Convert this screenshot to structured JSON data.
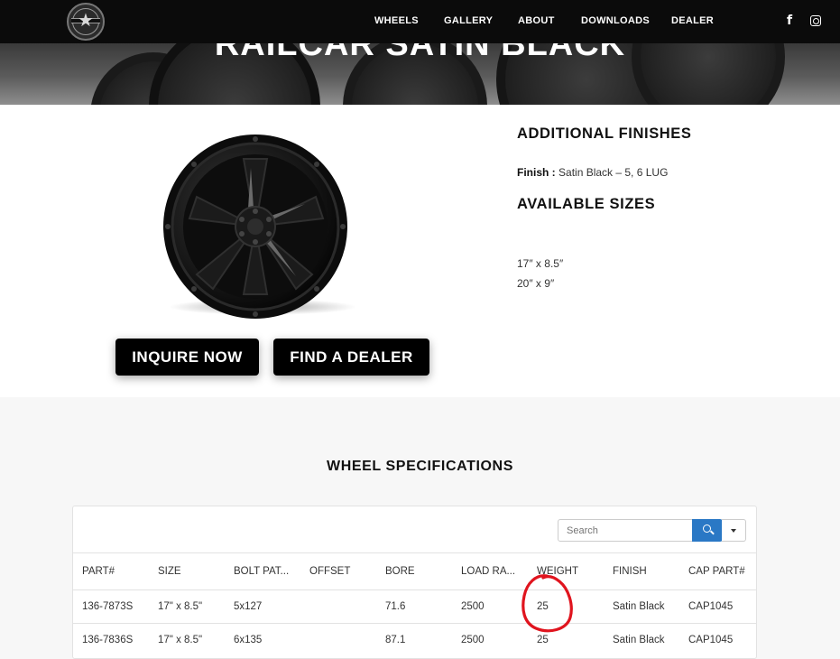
{
  "nav": {
    "items": [
      "WHEELS",
      "GALLERY",
      "ABOUT",
      "DOWNLOADS",
      "DEALER"
    ],
    "facebook_glyph": "f"
  },
  "hero": {
    "title": "RAILCAR SATIN BLACK"
  },
  "buttons": {
    "inquire": "INQUIRE NOW",
    "dealer": "FIND A DEALER"
  },
  "finishes": {
    "heading": "ADDITIONAL FINISHES",
    "label": "Finish :",
    "value": "Satin Black – 5, 6 LUG"
  },
  "sizes": {
    "heading": "AVAILABLE SIZES",
    "items": [
      "17″ x 8.5″",
      "20″ x 9″"
    ]
  },
  "specs": {
    "title": "WHEEL SPECIFICATIONS",
    "search_placeholder": "Search",
    "columns": [
      "PART#",
      "SIZE",
      "BOLT PAT...",
      "OFFSET",
      "BORE",
      "LOAD RA...",
      "WEIGHT",
      "FINISH",
      "CAP PART#"
    ],
    "rows": [
      [
        "136-7873S",
        "17\" x 8.5\"",
        "5x127",
        "",
        "71.6",
        "2500",
        "25",
        "Satin Black",
        "CAP1045"
      ],
      [
        "136-7836S",
        "17\" x 8.5\"",
        "6x135",
        "",
        "87.1",
        "2500",
        "25",
        "Satin Black",
        "CAP1045"
      ]
    ]
  },
  "colors": {
    "accent": "#2a78c5",
    "annotation": "#e0141e",
    "nav_bg": "#0b0b0b"
  }
}
